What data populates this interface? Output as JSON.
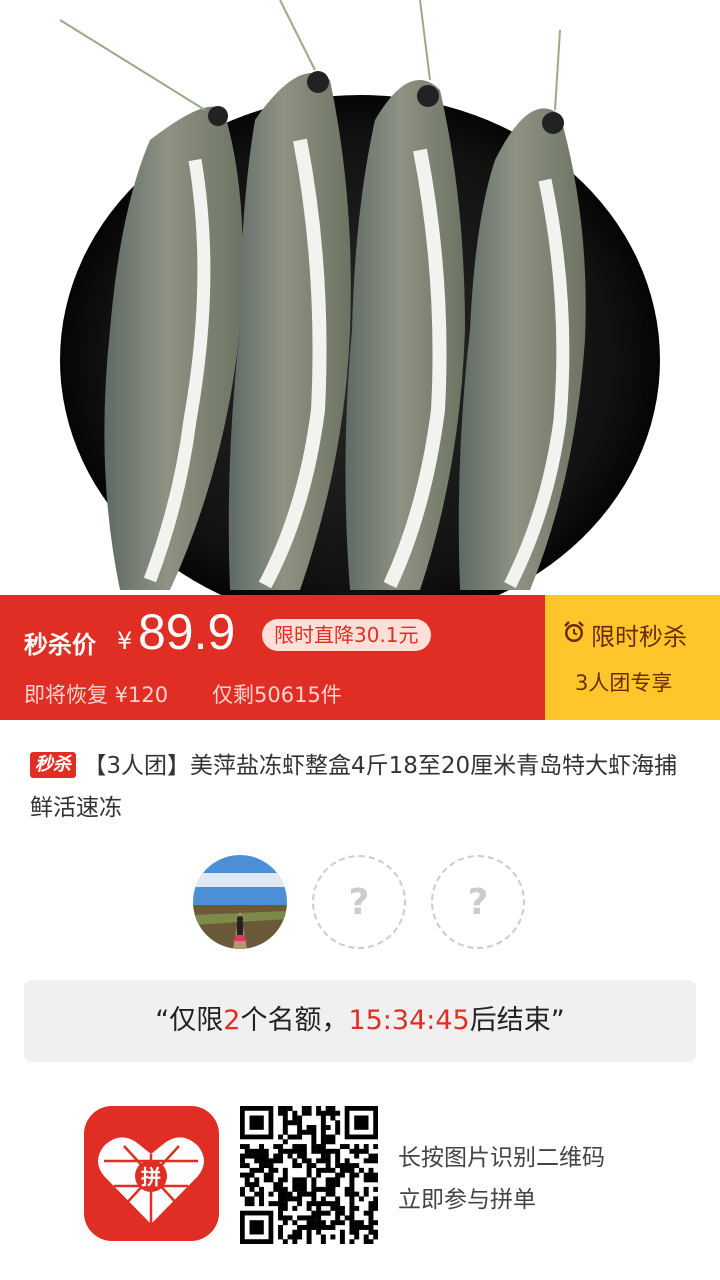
{
  "price_bar": {
    "sale_label": "秒杀价",
    "currency": "¥",
    "price": "89.9",
    "discount_tag": "限时直降30.1元",
    "restore_text": "即将恢复 ¥120",
    "stock_text": "仅剩50615件",
    "flash_title": "限时秒杀",
    "flash_sub": "3人团专享"
  },
  "product": {
    "badge": "秒杀",
    "title": "【3人团】美萍盐冻虾整盒4斤18至20厘米青岛特大虾海捕鲜活速冻"
  },
  "group": {
    "empty_slot_symbol": "?"
  },
  "countdown": {
    "prefix": "“仅限",
    "count": "2",
    "mid": "个名额，",
    "time": "15:34:45",
    "suffix": "后结束”"
  },
  "footer": {
    "hint_line1": "长按图片识别二维码",
    "hint_line2": "立即参与拼单",
    "logo_char": "拼"
  },
  "colors": {
    "brand_red": "#e02e24",
    "flash_yellow": "#ffc62b"
  }
}
